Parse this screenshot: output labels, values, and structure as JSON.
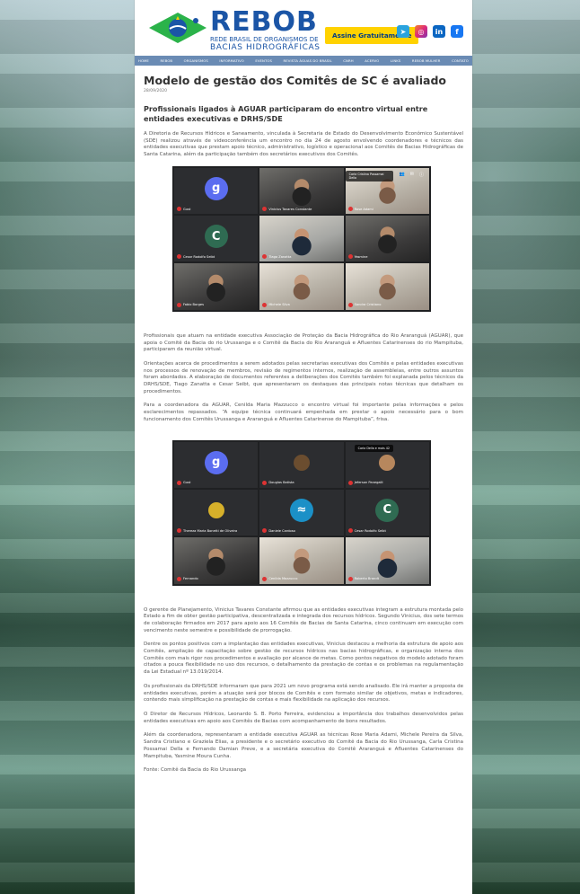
{
  "brand": {
    "logo_main": "REBOB",
    "logo_sub1": "REDE BRASIL DE ORGANISMOS DE",
    "logo_sub2": "BACIAS HIDROGRÁFICAS",
    "subscribe_label": "Assine Gratuitamente",
    "social": [
      "telegram",
      "instagram",
      "linkedin",
      "facebook"
    ]
  },
  "nav": {
    "items": [
      "HOME",
      "REBOB",
      "ORGANISMOS",
      "INFORMATIVO",
      "EVENTOS",
      "REVISTA ÁGUAS DO BRASIL",
      "CNRH",
      "ACERVO",
      "LINKS",
      "REBOB MULHER",
      "CONTATO"
    ]
  },
  "article": {
    "title": "Modelo de gestão dos Comitês de SC é avaliado",
    "date": "28/09/2020",
    "subtitle": "Profissionais ligados à AGUAR participaram do encontro virtual entre entidades executivas e DRHS/SDE",
    "p1": "A Diretoria de Recursos Hídricos e Saneamento, vinculada à Secretaria de Estado do Desenvolvimento Econômico Sustentável (SDE) realizou através de videoconferência um encontro no dia 24 de agosto envolvendo coordenadores e técnicos das entidades executivas que prestam apoio técnico, administrativo, logístico e operacional aos Comitês de Bacias Hidrográficas de Santa Catarina, além da participação também dos secretários executivos dos Comitês.",
    "p2": "Profissionais que atuam na entidade executiva Associação de Proteção da Bacia Hidrográfica do Rio Araranguá (AGUAR), que apoia o Comitê da Bacia do rio Urussanga e o Comitê da Bacia do Rio Araranguá e Afluentes Catarinenses do rio Mampituba, participaram da reunião virtual.",
    "p3": "Orientações acerca de procedimentos a serem adotados pelas secretarias executivas dos Comitês e pelas entidades executivas nos processos de renovação de membros, revisão de regimentos internos, realização de assembleias, entre outros assuntos foram abordados. A elaboração de documentos referentes a deliberações dos Comitês também foi explanada pelos técnicos da DRHS/SDE, Tiago Zanatta e Cesar Seibt, que apresentaram os destaques das principais notas técnicas que detalham os procedimentos.",
    "p4": "Para a coordenadora da AGUAR, Cenilda Maria Mazzucco o encontro virtual foi importante pelas informações e pelos esclarecimentos repassados. “A equipe técnica continuará empenhada em prestar o apoio necessário para o bom funcionamento dos Comitês Urussanga e Araranguá e Afluentes Catarinense do Mampituba”, frisa.",
    "p5": "O gerente de Planejamento, Vinicius Tavares Constante afirmou que as entidades executivas integram a estrutura montada pelo Estado a fim de obter gestão participativa, descentralizada e integrada dos recursos hídricos. Segundo Vinicius, dos sete termos de colaboração firmados em 2017 para apoio aos 16 Comitês de Bacias de Santa Catarina, cinco continuam em execução com vencimento neste semestre e possibilidade de prorrogação.",
    "p6": "Dentre os pontos positivos com a implantação das entidades executivas, Vinicius destacou a melhoria da estrutura de apoio aos Comitês, ampliação de capacitação sobre gestão de recursos hídricos nas bacias hidrográficas, e organização interna dos Comitês com mais rigor nos procedimentos e avaliação por alcance de metas. Como pontos negativos do modelo adotado foram citados a pouca flexibilidade no uso dos recursos, o detalhamento da prestação de contas e os problemas na regulamentação da Lei Estadual nº 13.019/2014.",
    "p7": "Os profissionais da DRHS/SDE informaram que para 2021 um novo programa está sendo analisado. Ele irá manter a proposta de entidades executivas, porém a atuação será por blocos de Comitês e com formato similar de objetivos, metas e indicadores, contendo mais simplificação na prestação de contas e mais flexibilidade na aplicação dos recursos.",
    "p8": "O Diretor de Recursos Hídricos, Leonardo S. B. Porto Ferreira, evidenciou a importância dos trabalhos desenvolvidos pelas entidades executivas em apoio aos Comitês de Bacias com acompanhamento de bons resultados.",
    "p9": "Além da coordenadora, representaram a entidade executiva AGUAR as técnicas Rose Maria Adami, Michele Pereira da Silva, Sandra Cristiano e Graziela Elias, a presidente e o secretário executivo do Comitê da Bacia do Rio Urussanga, Carla Cristina Possamai Della e Fernando Damian Preve, e a secretária executiva do Comitê Araranguá e Afluentes Catarinenses do Mampituba, Yasmine Moura Cunha.",
    "source": "Fonte: Comitê da Bacia do Rio Urussanga"
  },
  "videocall1": {
    "tiles": [
      {
        "kind": "avatar",
        "letter": "g",
        "name": "Gust"
      },
      {
        "kind": "cam",
        "name": "Vinicius Tavares Constante"
      },
      {
        "kind": "cam",
        "name": "Rose Adami"
      },
      {
        "kind": "avatar",
        "letter": "C",
        "name": "Cesar Rodolfo Seibt"
      },
      {
        "kind": "cam",
        "name": "Tiago Zanatta"
      },
      {
        "kind": "cam",
        "name": "Yasmine"
      },
      {
        "kind": "cam",
        "name": "Fabio Borges"
      },
      {
        "kind": "cam",
        "name": "Michele Silva"
      },
      {
        "kind": "cam",
        "name": "Sandra Cristiano"
      }
    ],
    "topbar": "Carla Cristina Possamai Della"
  },
  "videocall2": {
    "tiles": [
      {
        "kind": "avatar",
        "letter": "g",
        "name": "Gust"
      },
      {
        "kind": "cam",
        "name": "Douglas Batista"
      },
      {
        "kind": "cam",
        "name": "Jeferson Panegalli"
      },
      {
        "kind": "cam",
        "name": "Thereza Maria Bonetti de Oliveira"
      },
      {
        "kind": "cam",
        "name": "Daniele Cardoso"
      },
      {
        "kind": "avatar",
        "letter": "C",
        "name": "Cesar Rodolfo Seibt"
      },
      {
        "kind": "cam",
        "name": "Fernando"
      },
      {
        "kind": "cam",
        "name": "Cenilda Mazzucco"
      },
      {
        "kind": "cam",
        "name": "Roberto Brandt"
      }
    ],
    "topbar": "Carla Della e mais 42"
  },
  "colors": {
    "brand_blue": "#1b55a6",
    "nav_bg": "#6a8bb4",
    "subscribe_bg": "#ffd200"
  }
}
